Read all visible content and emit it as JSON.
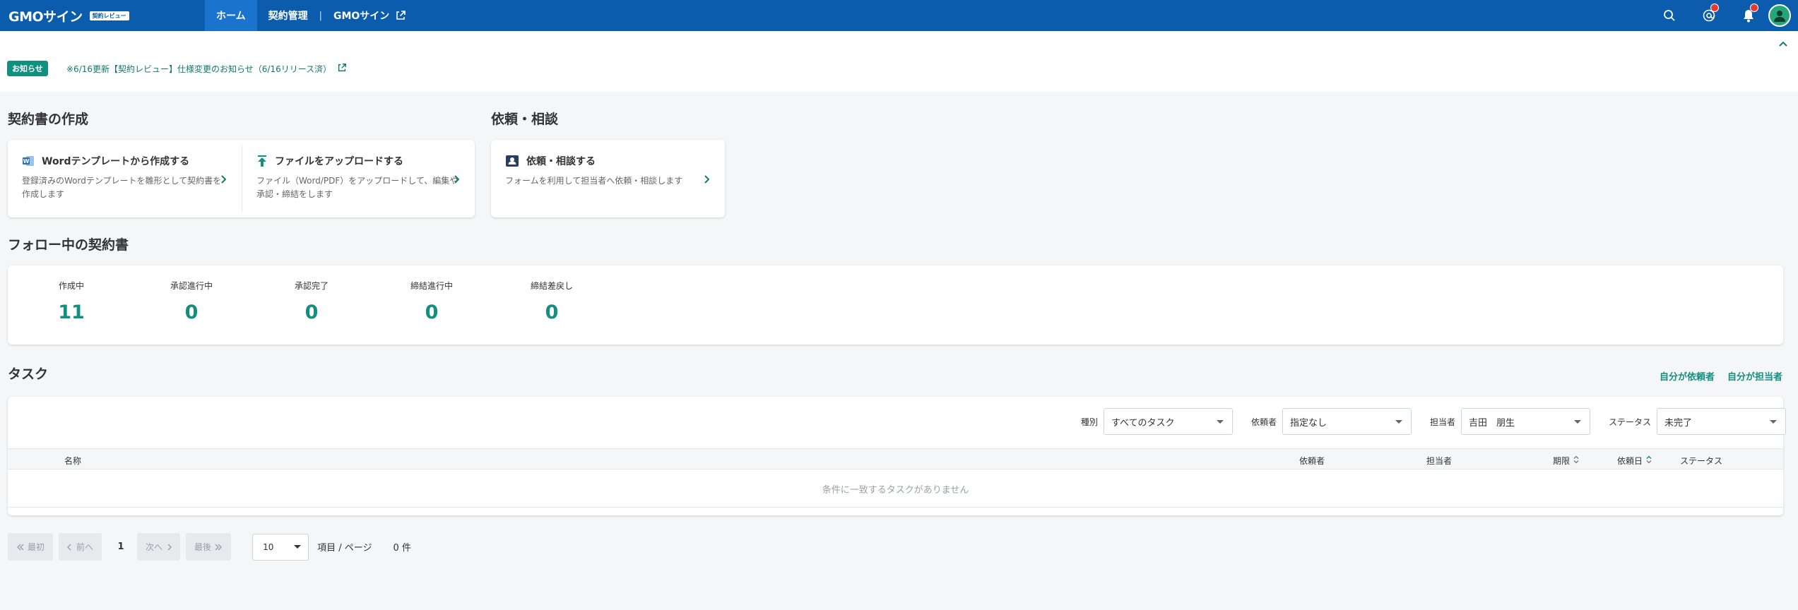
{
  "header": {
    "logo": "GMOサイン",
    "logo_badge": "契約レビュー",
    "nav": [
      {
        "label": "ホーム"
      },
      {
        "label": "契約管理"
      },
      {
        "label": "GMOサイン"
      }
    ]
  },
  "notice": {
    "badge": "お知らせ",
    "text": "※6/16更新【契約レビュー】仕様変更のお知らせ（6/16リリース済）"
  },
  "create": {
    "title": "契約書の作成",
    "items": [
      {
        "title": "Wordテンプレートから作成する",
        "desc": "登録済みのWordテンプレートを雛形として契約書を作成します"
      },
      {
        "title": "ファイルをアップロードする",
        "desc": "ファイル（Word/PDF）をアップロードして、編集や承認・締結をします"
      }
    ]
  },
  "consult": {
    "title": "依頼・相談",
    "item": {
      "title": "依頼・相談する",
      "desc": "フォームを利用して担当者へ依頼・相談します"
    }
  },
  "follow": {
    "title": "フォロー中の契約書",
    "stats": [
      {
        "label": "作成中",
        "value": "11"
      },
      {
        "label": "承認進行中",
        "value": "0"
      },
      {
        "label": "承認完了",
        "value": "0"
      },
      {
        "label": "締結進行中",
        "value": "0"
      },
      {
        "label": "締結差戻し",
        "value": "0"
      }
    ]
  },
  "task": {
    "title": "タスク",
    "links": [
      "自分が依頼者",
      "自分が担当者"
    ],
    "filters": [
      {
        "label": "種別",
        "value": "すべてのタスク"
      },
      {
        "label": "依頼者",
        "value": "指定なし"
      },
      {
        "label": "担当者",
        "value": "吉田　朋生"
      },
      {
        "label": "ステータス",
        "value": "未完了"
      }
    ],
    "columns": [
      "名称",
      "依頼者",
      "担当者",
      "期限",
      "依頼日",
      "ステータス"
    ],
    "empty": "条件に一致するタスクがありません"
  },
  "pagination": {
    "first": "最初",
    "prev": "前へ",
    "page": "1",
    "next": "次へ",
    "last": "最後",
    "page_size": "10",
    "per_page_label": "項目 / ページ",
    "total": "0 件"
  },
  "colors": {
    "brand": "#0b5cad",
    "accent": "#138f80"
  }
}
